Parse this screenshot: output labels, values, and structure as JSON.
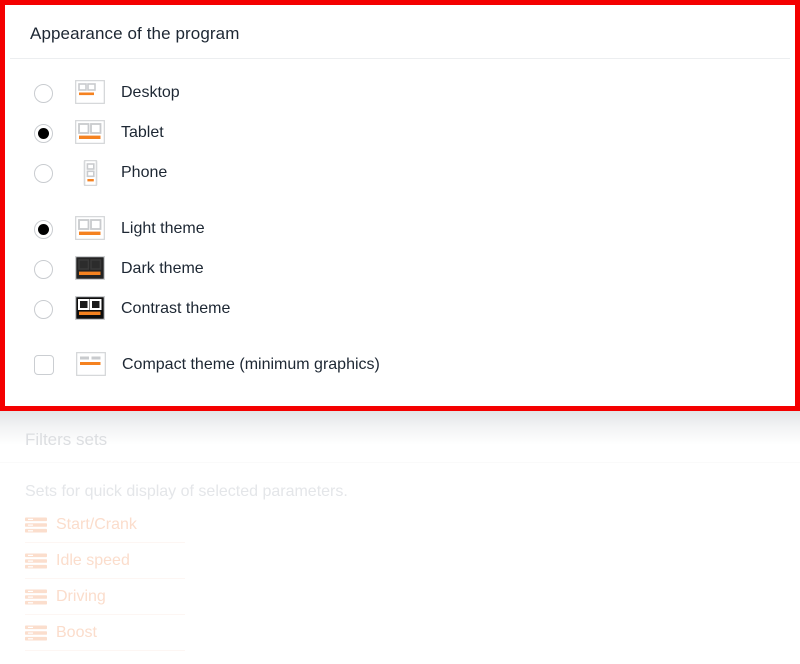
{
  "highlight": {
    "color": "#f40000"
  },
  "card": {
    "title": "Appearance of the program",
    "layout_options": [
      {
        "label": "Desktop",
        "icon": "layout-desktop-icon",
        "selected": false
      },
      {
        "label": "Tablet",
        "icon": "layout-tablet-icon",
        "selected": true
      },
      {
        "label": "Phone",
        "icon": "layout-phone-icon",
        "selected": false
      }
    ],
    "theme_options": [
      {
        "label": "Light theme",
        "icon": "theme-light-icon",
        "selected": true
      },
      {
        "label": "Dark theme",
        "icon": "theme-dark-icon",
        "selected": false
      },
      {
        "label": "Contrast theme",
        "icon": "theme-contrast-icon",
        "selected": false
      }
    ],
    "compact_option": {
      "label": "Compact theme (minimum graphics)",
      "icon": "theme-compact-icon",
      "checked": false
    }
  },
  "filters_section": {
    "title": "Filters sets",
    "description": "Sets for quick display of selected parameters.",
    "items": [
      {
        "label": "Start/Crank",
        "icon": "filter-set-icon"
      },
      {
        "label": "Idle speed",
        "icon": "filter-set-icon"
      },
      {
        "label": "Driving",
        "icon": "filter-set-icon"
      },
      {
        "label": "Boost",
        "icon": "filter-set-icon"
      }
    ]
  },
  "colors": {
    "accent_orange": "#f58220",
    "text_dark": "#1d2733",
    "highlight_red": "#f40000"
  }
}
